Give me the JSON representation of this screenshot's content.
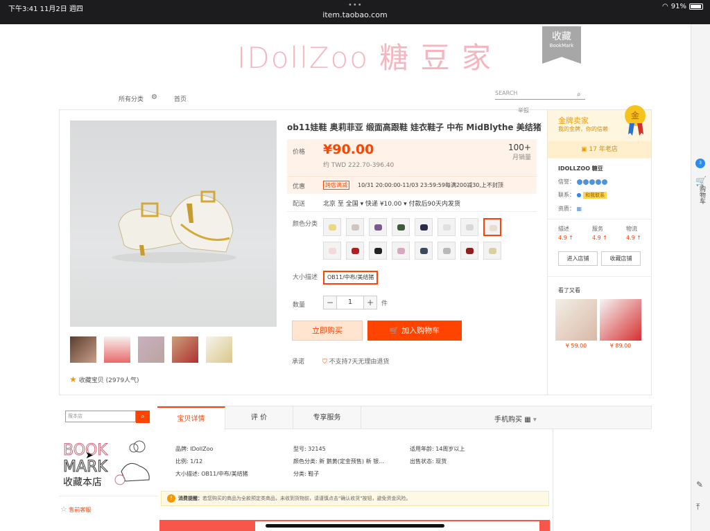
{
  "status_bar": {
    "time": "下午3:41  11月2日 週四",
    "url": "item.taobao.com",
    "battery": "91%"
  },
  "rail": {
    "badge": "3",
    "cart_label": "购物车"
  },
  "banner": {
    "title": "IDollZoo 糖 豆 家",
    "bookmark_cn": "收藏",
    "bookmark_en": "BookMark"
  },
  "nav": {
    "all_categories": "所有分类",
    "home": "首页",
    "search_placeholder": "SEARCH",
    "report": "举报"
  },
  "product": {
    "title": "ob11娃鞋 奥莉菲亚 缎面高跟鞋 娃衣鞋子 中布 MidBlythe 美结猪",
    "price_label": "价格",
    "price": "¥90.00",
    "price_twd": "约 TWD 222.70-396.40",
    "sales_count": "100+",
    "sales_label": "月销量",
    "promo_label": "优惠",
    "promo_tag": "跨店满减",
    "promo_text": "10/31 20:00:00-11/03 23:59:59每满200减30,上不封顶",
    "ship_label": "配送",
    "ship_text": "北京 至  全国 ▾    快递 ¥10.00 ▾   付款后90天内发货",
    "color_label": "颜色分类",
    "size_label": "大小描述",
    "size_option": "OB11/中布/美结猪",
    "qty_label": "数量",
    "qty_minus": "−",
    "qty_value": "1",
    "qty_plus": "+",
    "qty_unit": "件",
    "buy_now": "立即购买",
    "add_cart": "加入购物车",
    "promise_label": "承诺",
    "promise_text": "不支持7天无理由退货",
    "favorite": "收藏宝贝 (2979人气)"
  },
  "shop": {
    "gold_title": "金牌卖家",
    "gold_sub": "我的金牌，你的信赖",
    "medal": "金",
    "years": "17 年老店",
    "name": "IDOLLZOO 糖豆",
    "credit_label": "信誉：",
    "contact_label": "联系：",
    "contact_text": "和我联系",
    "qual_label": "资质：",
    "rating_desc": "描述",
    "rating_service": "服务",
    "rating_logistics": "物流",
    "rating_desc_v": "4.9 ↑",
    "rating_service_v": "4.9 ↑",
    "rating_logistics_v": "4.9 ↑",
    "enter_shop": "进入店铺",
    "fav_shop": "收藏店铺",
    "seen_title": "看了又看",
    "seen_price_1": "¥ 59.00",
    "seen_price_2": "¥ 89.00"
  },
  "lower": {
    "store_search_placeholder": "搜本店",
    "service": "售前客服",
    "tab_detail": "宝贝详情",
    "tab_reviews": "评 价",
    "tab_service": "专享服务",
    "mobile_buy": "手机购买",
    "attr_brand": "品牌: IDollZoo",
    "attr_model": "型号: 32145",
    "attr_age": "适用年龄: 14周岁以上",
    "attr_scale": "比例: 1/12",
    "attr_color": "颜色分类: 新 鹅黄(定金预售) 新 银...",
    "attr_status": "出售状态: 现货",
    "attr_size": "大小描述: OB11/中布/美结猪",
    "attr_type": "分类: 鞋子",
    "notice_bold": "消费提醒：",
    "notice_text": "若您购买的商品为全款预定类商品，未收到货物前，请谨慎点击\"确认收货\"按钮，避免资金风险。"
  },
  "colors": {
    "accent": "#ff4400",
    "price_bg": "#fff2e8",
    "banner_pink": "#f5b6c0"
  }
}
